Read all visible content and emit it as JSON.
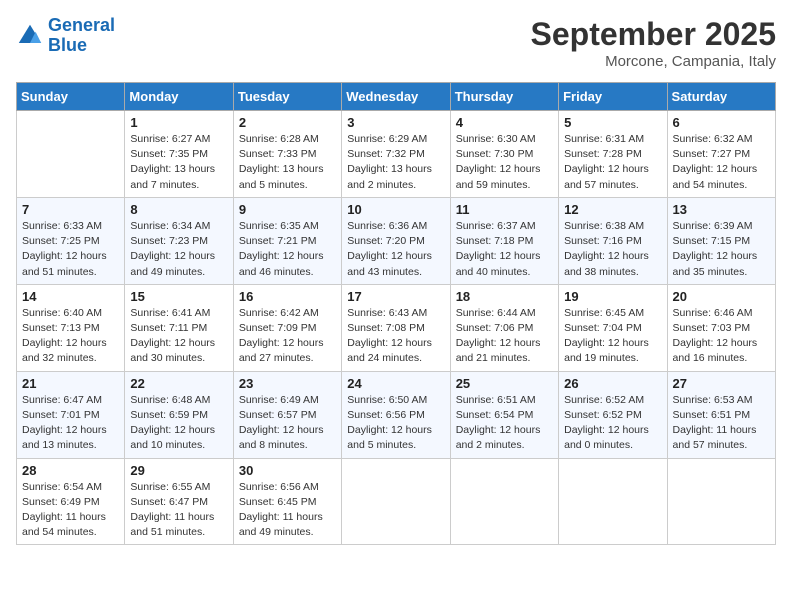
{
  "logo": {
    "line1": "General",
    "line2": "Blue"
  },
  "title": "September 2025",
  "location": "Morcone, Campania, Italy",
  "weekdays": [
    "Sunday",
    "Monday",
    "Tuesday",
    "Wednesday",
    "Thursday",
    "Friday",
    "Saturday"
  ],
  "weeks": [
    [
      {
        "day": "",
        "info": ""
      },
      {
        "day": "1",
        "info": "Sunrise: 6:27 AM\nSunset: 7:35 PM\nDaylight: 13 hours\nand 7 minutes."
      },
      {
        "day": "2",
        "info": "Sunrise: 6:28 AM\nSunset: 7:33 PM\nDaylight: 13 hours\nand 5 minutes."
      },
      {
        "day": "3",
        "info": "Sunrise: 6:29 AM\nSunset: 7:32 PM\nDaylight: 13 hours\nand 2 minutes."
      },
      {
        "day": "4",
        "info": "Sunrise: 6:30 AM\nSunset: 7:30 PM\nDaylight: 12 hours\nand 59 minutes."
      },
      {
        "day": "5",
        "info": "Sunrise: 6:31 AM\nSunset: 7:28 PM\nDaylight: 12 hours\nand 57 minutes."
      },
      {
        "day": "6",
        "info": "Sunrise: 6:32 AM\nSunset: 7:27 PM\nDaylight: 12 hours\nand 54 minutes."
      }
    ],
    [
      {
        "day": "7",
        "info": "Sunrise: 6:33 AM\nSunset: 7:25 PM\nDaylight: 12 hours\nand 51 minutes."
      },
      {
        "day": "8",
        "info": "Sunrise: 6:34 AM\nSunset: 7:23 PM\nDaylight: 12 hours\nand 49 minutes."
      },
      {
        "day": "9",
        "info": "Sunrise: 6:35 AM\nSunset: 7:21 PM\nDaylight: 12 hours\nand 46 minutes."
      },
      {
        "day": "10",
        "info": "Sunrise: 6:36 AM\nSunset: 7:20 PM\nDaylight: 12 hours\nand 43 minutes."
      },
      {
        "day": "11",
        "info": "Sunrise: 6:37 AM\nSunset: 7:18 PM\nDaylight: 12 hours\nand 40 minutes."
      },
      {
        "day": "12",
        "info": "Sunrise: 6:38 AM\nSunset: 7:16 PM\nDaylight: 12 hours\nand 38 minutes."
      },
      {
        "day": "13",
        "info": "Sunrise: 6:39 AM\nSunset: 7:15 PM\nDaylight: 12 hours\nand 35 minutes."
      }
    ],
    [
      {
        "day": "14",
        "info": "Sunrise: 6:40 AM\nSunset: 7:13 PM\nDaylight: 12 hours\nand 32 minutes."
      },
      {
        "day": "15",
        "info": "Sunrise: 6:41 AM\nSunset: 7:11 PM\nDaylight: 12 hours\nand 30 minutes."
      },
      {
        "day": "16",
        "info": "Sunrise: 6:42 AM\nSunset: 7:09 PM\nDaylight: 12 hours\nand 27 minutes."
      },
      {
        "day": "17",
        "info": "Sunrise: 6:43 AM\nSunset: 7:08 PM\nDaylight: 12 hours\nand 24 minutes."
      },
      {
        "day": "18",
        "info": "Sunrise: 6:44 AM\nSunset: 7:06 PM\nDaylight: 12 hours\nand 21 minutes."
      },
      {
        "day": "19",
        "info": "Sunrise: 6:45 AM\nSunset: 7:04 PM\nDaylight: 12 hours\nand 19 minutes."
      },
      {
        "day": "20",
        "info": "Sunrise: 6:46 AM\nSunset: 7:03 PM\nDaylight: 12 hours\nand 16 minutes."
      }
    ],
    [
      {
        "day": "21",
        "info": "Sunrise: 6:47 AM\nSunset: 7:01 PM\nDaylight: 12 hours\nand 13 minutes."
      },
      {
        "day": "22",
        "info": "Sunrise: 6:48 AM\nSunset: 6:59 PM\nDaylight: 12 hours\nand 10 minutes."
      },
      {
        "day": "23",
        "info": "Sunrise: 6:49 AM\nSunset: 6:57 PM\nDaylight: 12 hours\nand 8 minutes."
      },
      {
        "day": "24",
        "info": "Sunrise: 6:50 AM\nSunset: 6:56 PM\nDaylight: 12 hours\nand 5 minutes."
      },
      {
        "day": "25",
        "info": "Sunrise: 6:51 AM\nSunset: 6:54 PM\nDaylight: 12 hours\nand 2 minutes."
      },
      {
        "day": "26",
        "info": "Sunrise: 6:52 AM\nSunset: 6:52 PM\nDaylight: 12 hours\nand 0 minutes."
      },
      {
        "day": "27",
        "info": "Sunrise: 6:53 AM\nSunset: 6:51 PM\nDaylight: 11 hours\nand 57 minutes."
      }
    ],
    [
      {
        "day": "28",
        "info": "Sunrise: 6:54 AM\nSunset: 6:49 PM\nDaylight: 11 hours\nand 54 minutes."
      },
      {
        "day": "29",
        "info": "Sunrise: 6:55 AM\nSunset: 6:47 PM\nDaylight: 11 hours\nand 51 minutes."
      },
      {
        "day": "30",
        "info": "Sunrise: 6:56 AM\nSunset: 6:45 PM\nDaylight: 11 hours\nand 49 minutes."
      },
      {
        "day": "",
        "info": ""
      },
      {
        "day": "",
        "info": ""
      },
      {
        "day": "",
        "info": ""
      },
      {
        "day": "",
        "info": ""
      }
    ]
  ]
}
